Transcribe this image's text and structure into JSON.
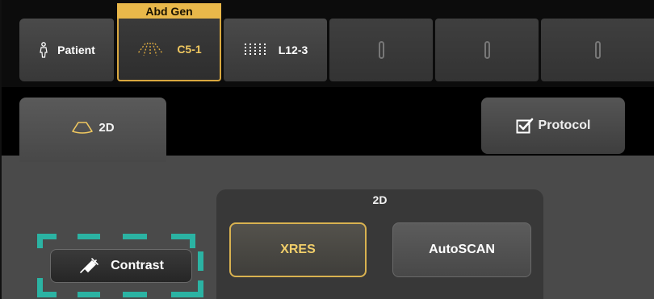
{
  "probe_bar": {
    "active_preset": "Abd Gen",
    "patient_label": "Patient",
    "probes": [
      {
        "label": "C5-1",
        "icon": "convex-probe-icon",
        "selected": true
      },
      {
        "label": "L12-3",
        "icon": "linear-probe-icon",
        "selected": false
      }
    ],
    "empty_slots": 3
  },
  "tabs": {
    "mode_label": "2D",
    "protocol_label": "Protocol"
  },
  "panel": {
    "group_title": "2D",
    "xres_label": "XRES",
    "autoscan_label": "AutoSCAN",
    "contrast_label": "Contrast"
  },
  "colors": {
    "accent_gold": "#d9b250",
    "highlight_teal": "#2bb3a3",
    "panel_bg": "#4a4a4a"
  }
}
